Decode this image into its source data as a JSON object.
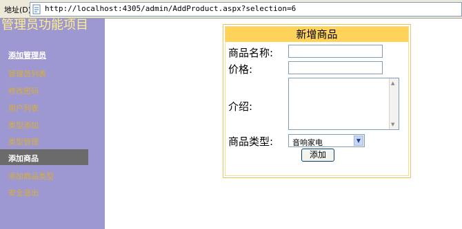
{
  "browser": {
    "address_label": "地址(D)",
    "url": "http://localhost:4305/admin/AddProduct.aspx?selection=6"
  },
  "sidebar": {
    "title": "管理员功能项目",
    "items": [
      {
        "label": "添加管理员"
      },
      {
        "label": "管理员列表"
      },
      {
        "label": "修改密码"
      },
      {
        "label": "用户列表"
      },
      {
        "label": "类型添加"
      },
      {
        "label": "类型管理"
      },
      {
        "label": "添加商品"
      },
      {
        "label": "添加商品类型"
      },
      {
        "label": "安全退出"
      }
    ]
  },
  "form": {
    "title": "新增商品",
    "name_label": "商品名称:",
    "price_label": "价格:",
    "intro_label": "介绍:",
    "category_label": "商品类型:",
    "category_selected": "音响家电",
    "submit_label": "添加"
  }
}
